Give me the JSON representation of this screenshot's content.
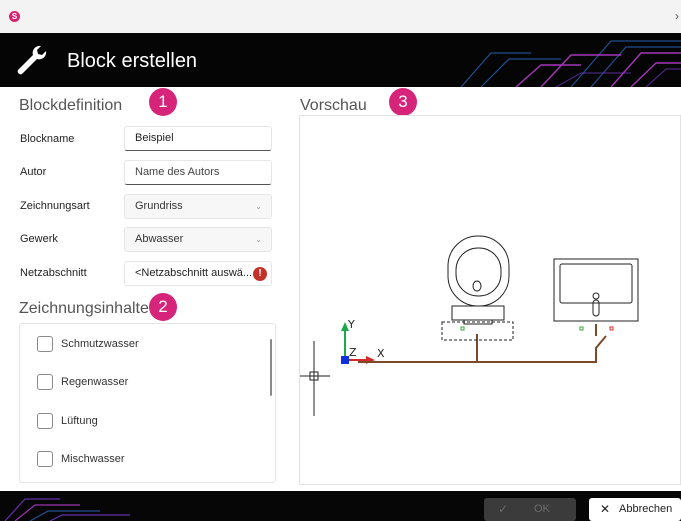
{
  "window": {
    "app_icon": "S",
    "close_glyph": "›"
  },
  "header": {
    "title": "Block erstellen",
    "icon": "wrench-icon"
  },
  "blockdefinition": {
    "title": "Blockdefinition",
    "badge": "1",
    "fields": {
      "blockname": {
        "label": "Blockname",
        "value": "Beispiel"
      },
      "autor": {
        "label": "Autor",
        "placeholder": "Name des Autors"
      },
      "zeichnungsart": {
        "label": "Zeichnungsart",
        "value": "Grundriss"
      },
      "gewerk": {
        "label": "Gewerk",
        "value": "Abwasser"
      },
      "netzabschnitt": {
        "label": "Netzabschnitt",
        "value": "<Netzabschnitt auswä...",
        "warning_glyph": "!"
      }
    }
  },
  "zeichnungsinhalte": {
    "title": "Zeichnungsinhalte",
    "badge": "2",
    "items": [
      {
        "label": "Schmutzwasser",
        "checked": false
      },
      {
        "label": "Regenwasser",
        "checked": false
      },
      {
        "label": "Lüftung",
        "checked": false
      },
      {
        "label": "Mischwasser",
        "checked": false
      }
    ]
  },
  "vorschau": {
    "title": "Vorschau",
    "badge": "3",
    "axis_labels": {
      "y": "Y",
      "z": "Z",
      "x": "X"
    }
  },
  "footer": {
    "ok_label": "OK",
    "cancel_label": "Abbrechen"
  },
  "colors": {
    "accent": "#d6247a",
    "pipe": "#7a4a2a",
    "header_bg": "#050505",
    "warning": "#c4312b"
  }
}
